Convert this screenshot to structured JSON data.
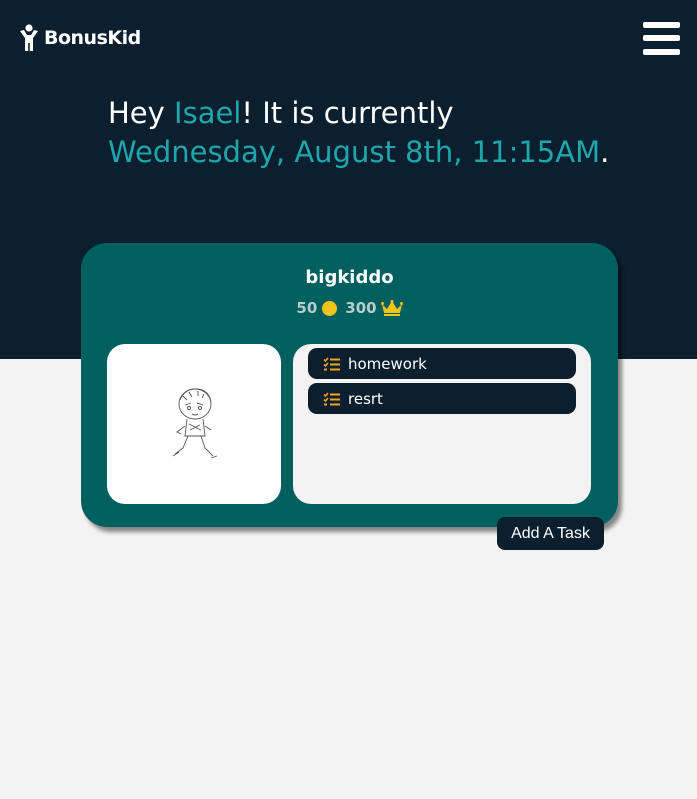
{
  "header": {
    "logo_text": "BonusKid",
    "logo_icon": "child-figure-icon",
    "menu_icon": "hamburger-menu-icon"
  },
  "greeting": {
    "prefix": "Hey ",
    "name": "Isael",
    "middle": "! It is currently ",
    "datetime": "Wednesday, August 8th, 11:15AM",
    "suffix": "."
  },
  "kid_card": {
    "username": "bigkiddo",
    "coins": "50",
    "coin_icon": "coin-icon",
    "points": "300",
    "points_icon": "crown-icon",
    "avatar_icon": "sketch-avatar-icon",
    "tasks": [
      {
        "label": "homework",
        "icon": "task-list-icon"
      },
      {
        "label": "resrt",
        "icon": "task-list-icon"
      }
    ]
  },
  "actions": {
    "add_task_label": "Add A Task"
  },
  "colors": {
    "header_bg": "#0b1f2f",
    "accent": "#1fa6ad",
    "card_bg": "#006060",
    "coin": "#f2c318",
    "task_icon": "#f2a31b",
    "page_bg": "#f3f3f3"
  }
}
